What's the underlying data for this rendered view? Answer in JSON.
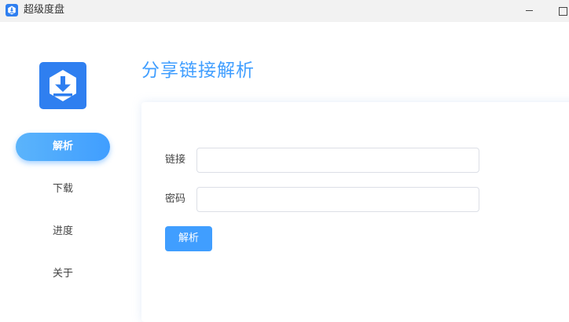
{
  "window": {
    "title": "超级度盘",
    "minimize_icon": "minimize-icon",
    "maximize_icon": "maximize-icon"
  },
  "sidebar": {
    "logo_icon": "download-hexagon-logo",
    "items": [
      {
        "label": "解析",
        "active": true
      },
      {
        "label": "下载",
        "active": false
      },
      {
        "label": "进度",
        "active": false
      },
      {
        "label": "关于",
        "active": false
      }
    ]
  },
  "main": {
    "title": "分享链接解析",
    "form": {
      "link_label": "链接",
      "link_value": "",
      "password_label": "密码",
      "password_value": "",
      "submit_label": "解析"
    }
  },
  "colors": {
    "accent": "#409eff",
    "brand": "#2f7ff0",
    "titlebar_bg": "#f2f2f2",
    "input_border": "#dcdfe6"
  }
}
